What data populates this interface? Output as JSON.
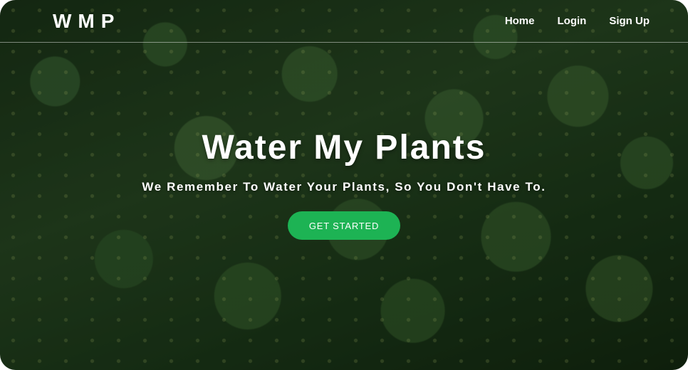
{
  "brand": {
    "logo_text": "WMP"
  },
  "nav": {
    "items": [
      {
        "label": "Home"
      },
      {
        "label": "Login"
      },
      {
        "label": "Sign Up"
      }
    ]
  },
  "hero": {
    "title": "Water My Plants",
    "subtitle": "We Remember To Water Your Plants, So You Don't Have To.",
    "cta_label": "GET STARTED",
    "cta_color": "#1db354",
    "background_image": "green leaves with water droplets"
  }
}
